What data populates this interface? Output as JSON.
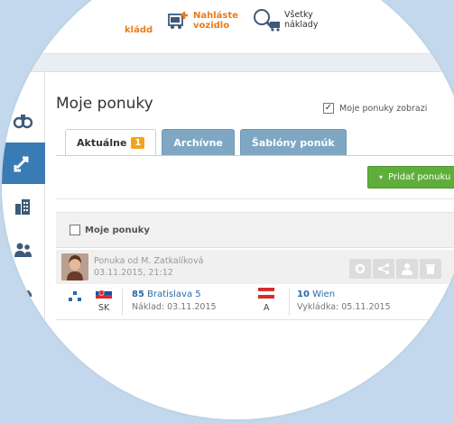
{
  "topbar": {
    "item1_line2": "kládd",
    "item2_line1": "Nahláste",
    "item2_line2": "vozidlo",
    "item3_line1": "Všetky",
    "item3_line2": "náklady"
  },
  "page": {
    "title": "Moje ponuky",
    "show_checkbox_label": "Moje ponuky zobrazi"
  },
  "tabs": [
    {
      "label": "Aktuálne",
      "badge": "1",
      "active": true
    },
    {
      "label": "Archívne",
      "active": false
    },
    {
      "label": "Šablóny ponúk",
      "active": false
    }
  ],
  "add_button": {
    "label": "Pridať ponuku"
  },
  "list": {
    "header_checkbox_label": "Moje ponuky"
  },
  "offer": {
    "from": "Ponuka od M. Zatkalíková",
    "date": "03.11.2015, 21:12",
    "origin": {
      "country": "SK",
      "postcode": "85",
      "city": "Bratislava 5",
      "date_label": "Náklad: 03.11.2015"
    },
    "destination": {
      "country": "A",
      "postcode": "10",
      "city": "Wien",
      "date_label": "Vykládka: 05.11.2015"
    }
  },
  "icons": {
    "sidebar": [
      "binoculars-icon",
      "exchange-icon",
      "building-icon",
      "users-icon",
      "truck-icon"
    ]
  },
  "colors": {
    "background": "#c3d8ec",
    "accent_blue": "#3a7bb3",
    "tab_inactive": "#7fa7c3",
    "add_green": "#5fae3c",
    "badge_orange": "#f2a31d",
    "brand_orange": "#ea7b1a",
    "link_blue": "#2c6aa8"
  }
}
